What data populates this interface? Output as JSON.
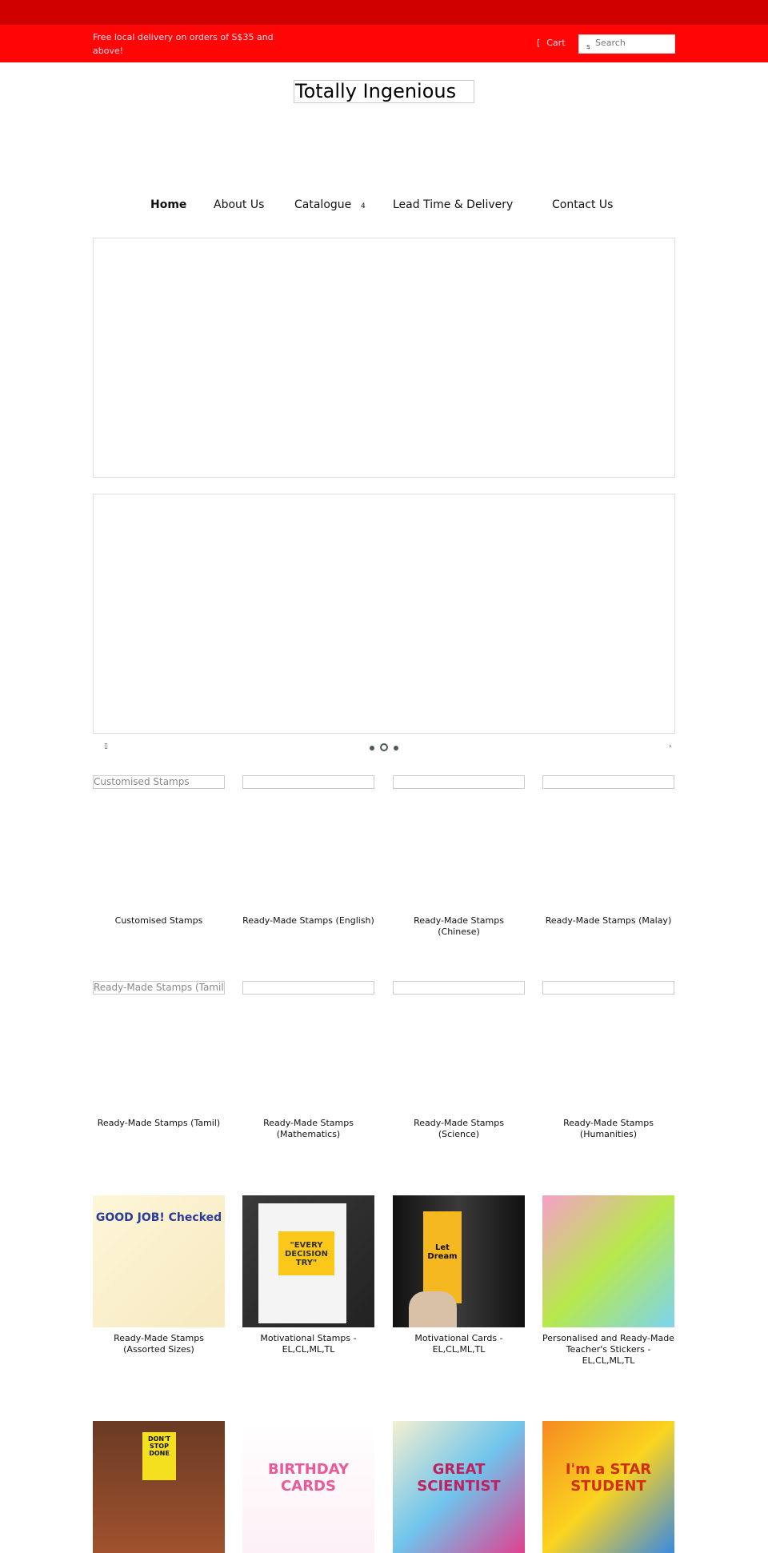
{
  "header": {
    "promo": "Free local delivery on orders of S$35 and above!",
    "cart_label": "Cart",
    "cart_icon": "[",
    "search_placeholder": "Search",
    "search_icon": "s",
    "logo": "Totally Ingenious"
  },
  "nav": {
    "items": [
      "Home",
      "About Us",
      "Catalogue",
      "Lead Time & Delivery",
      "Contact Us"
    ],
    "caret": "4"
  },
  "slider": {
    "prev": "▯",
    "next": "›",
    "slides": 3,
    "active": 2
  },
  "row1": [
    {
      "alt": "Customised Stamps",
      "label": "Customised Stamps"
    },
    {
      "alt": "",
      "label": "Ready-Made Stamps (English)"
    },
    {
      "alt": "",
      "label": "Ready-Made Stamps (Chinese)"
    },
    {
      "alt": "",
      "label": "Ready-Made Stamps (Malay)"
    }
  ],
  "row2": [
    {
      "alt": "Ready-Made Stamps (Tamil)",
      "label": "Ready-Made Stamps (Tamil)"
    },
    {
      "alt": "",
      "label": "Ready-Made Stamps (Mathematics)"
    },
    {
      "alt": "",
      "label": "Ready-Made Stamps (Science)"
    },
    {
      "alt": "",
      "label": "Ready-Made Stamps (Humanities)"
    }
  ],
  "row3": [
    {
      "label": "Ready-Made Stamps (Assorted Sizes)",
      "img_text": "GOOD JOB! Checked"
    },
    {
      "label": "Motivational Stamps - EL,CL,ML,TL",
      "img_text": "\"EVERY DECISION TRY\""
    },
    {
      "label": "Motivational Cards - EL,CL,ML,TL",
      "img_text": "Let Dream"
    },
    {
      "label": "Personalised and Ready-Made Teacher's Stickers - EL,CL,ML,TL",
      "img_text": ""
    }
  ],
  "row4": [
    {
      "img_text": "DON'T STOP DONE"
    },
    {
      "img_text": "BIRTHDAY CARDS"
    },
    {
      "img_text": "GREAT SCIENTIST"
    },
    {
      "img_text": "I'm a STAR STUDENT"
    }
  ],
  "colors": {
    "topbar": "#d10000",
    "bar": "#ff0505"
  }
}
